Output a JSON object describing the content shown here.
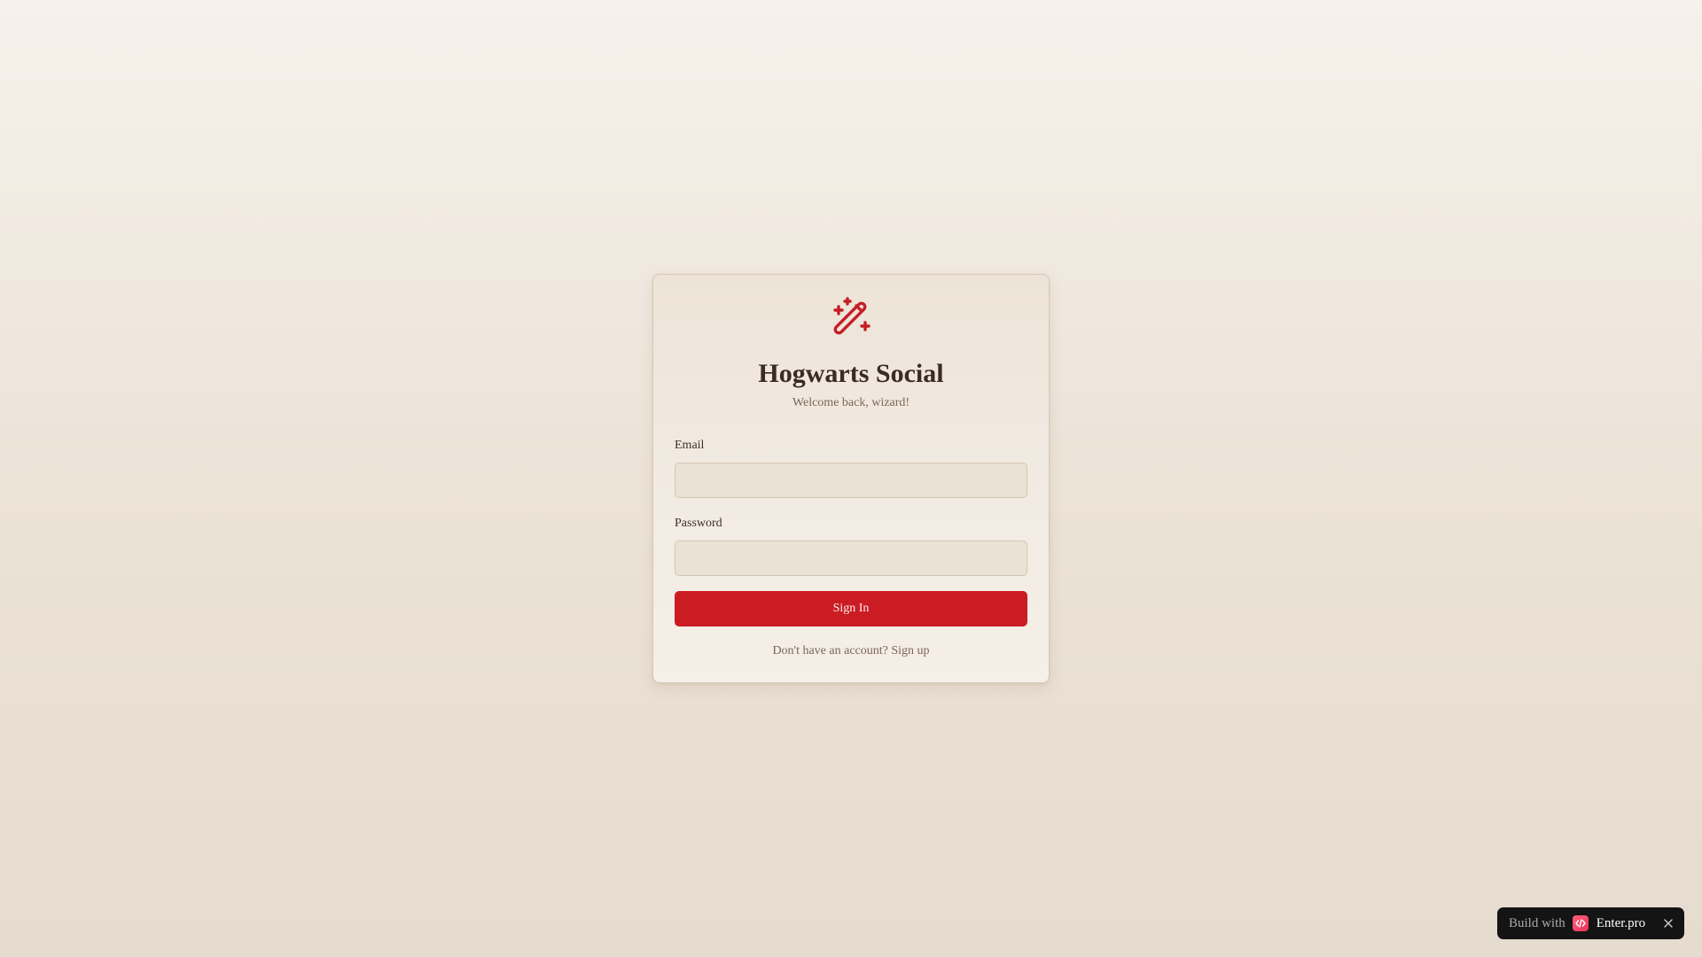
{
  "app": {
    "title": "Hogwarts Social",
    "subtitle": "Welcome back, wizard!",
    "logo_icon": "magic-wand-icon",
    "accent_color": "#cb1c23"
  },
  "form": {
    "email_label": "Email",
    "email_value": "",
    "email_placeholder": "",
    "password_label": "Password",
    "password_value": "",
    "password_placeholder": "",
    "submit_label": "Sign In"
  },
  "footer": {
    "prompt": "Don't have an account?",
    "link_label": "Sign up"
  },
  "badge": {
    "prefix": "Build with",
    "brand": "Enter.pro",
    "logo_icon": "code-brand-icon",
    "close_icon": "close-icon"
  }
}
